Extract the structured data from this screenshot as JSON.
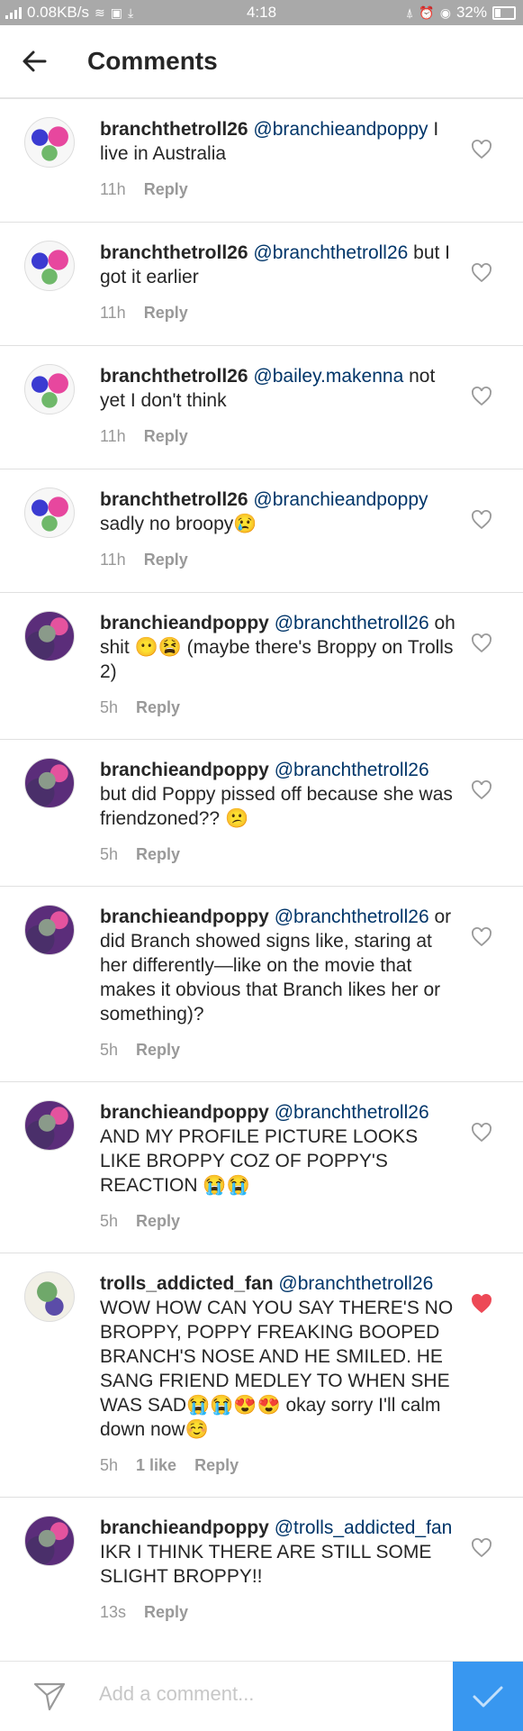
{
  "status_bar": {
    "network_speed": "0.08KB/s",
    "time": "4:18",
    "battery": "32%"
  },
  "header": {
    "title": "Comments"
  },
  "comments": [
    {
      "username": "branchthetroll26",
      "mention": "@branchieandpoppy",
      "text": " I live in Australia",
      "time": "11h",
      "likes": "",
      "reply_label": "Reply",
      "liked": false
    },
    {
      "username": "branchthetroll26",
      "mention": "@branchthetroll26",
      "text": " but I got it earlier",
      "time": "11h",
      "likes": "",
      "reply_label": "Reply",
      "liked": false
    },
    {
      "username": "branchthetroll26",
      "mention": "@bailey.makenna",
      "text": " not yet I don't think",
      "time": "11h",
      "likes": "",
      "reply_label": "Reply",
      "liked": false
    },
    {
      "username": "branchthetroll26",
      "mention": "@branchieandpoppy",
      "text": " sadly no broopy😢",
      "time": "11h",
      "likes": "",
      "reply_label": "Reply",
      "liked": false
    },
    {
      "username": "branchieandpoppy",
      "mention": "@branchthetroll26",
      "text": " oh shit 😶😫 (maybe there's Broppy on Trolls 2)",
      "time": "5h",
      "likes": "",
      "reply_label": "Reply",
      "liked": false
    },
    {
      "username": "branchieandpoppy",
      "mention": "@branchthetroll26",
      "text": " but did Poppy pissed off because she was friendzoned?? 😕",
      "time": "5h",
      "likes": "",
      "reply_label": "Reply",
      "liked": false
    },
    {
      "username": "branchieandpoppy",
      "mention": "@branchthetroll26",
      "text": " or did Branch showed signs like, staring at her differently—like on the movie that makes it obvious that Branch likes her or something)?",
      "time": "5h",
      "likes": "",
      "reply_label": "Reply",
      "liked": false
    },
    {
      "username": "branchieandpoppy",
      "mention": "@branchthetroll26",
      "text": " AND MY PROFILE PICTURE LOOKS LIKE BROPPY COZ OF POPPY'S REACTION 😭😭",
      "time": "5h",
      "likes": "",
      "reply_label": "Reply",
      "liked": false
    },
    {
      "username": "trolls_addicted_fan",
      "mention": "@branchthetroll26",
      "text": " WOW HOW CAN YOU SAY THERE'S NO BROPPY, POPPY FREAKING BOOPED BRANCH'S NOSE AND HE SMILED. HE SANG FRIEND MEDLEY TO WHEN SHE WAS SAD😭😭😍😍 okay sorry I'll calm down now☺️",
      "time": "5h",
      "likes": "1 like",
      "reply_label": "Reply",
      "liked": true
    },
    {
      "username": "branchieandpoppy",
      "mention": "@trolls_addicted_fan",
      "text": " IKR I THINK THERE ARE STILL SOME SLIGHT BROPPY!!",
      "time": "13s",
      "likes": "",
      "reply_label": "Reply",
      "liked": false
    }
  ],
  "composer": {
    "placeholder": "Add a comment..."
  },
  "colors": {
    "status_bar_bg": "#a9a9a9",
    "mention": "#003569",
    "liked_heart": "#ed4956",
    "post_button": "#3897f0"
  }
}
